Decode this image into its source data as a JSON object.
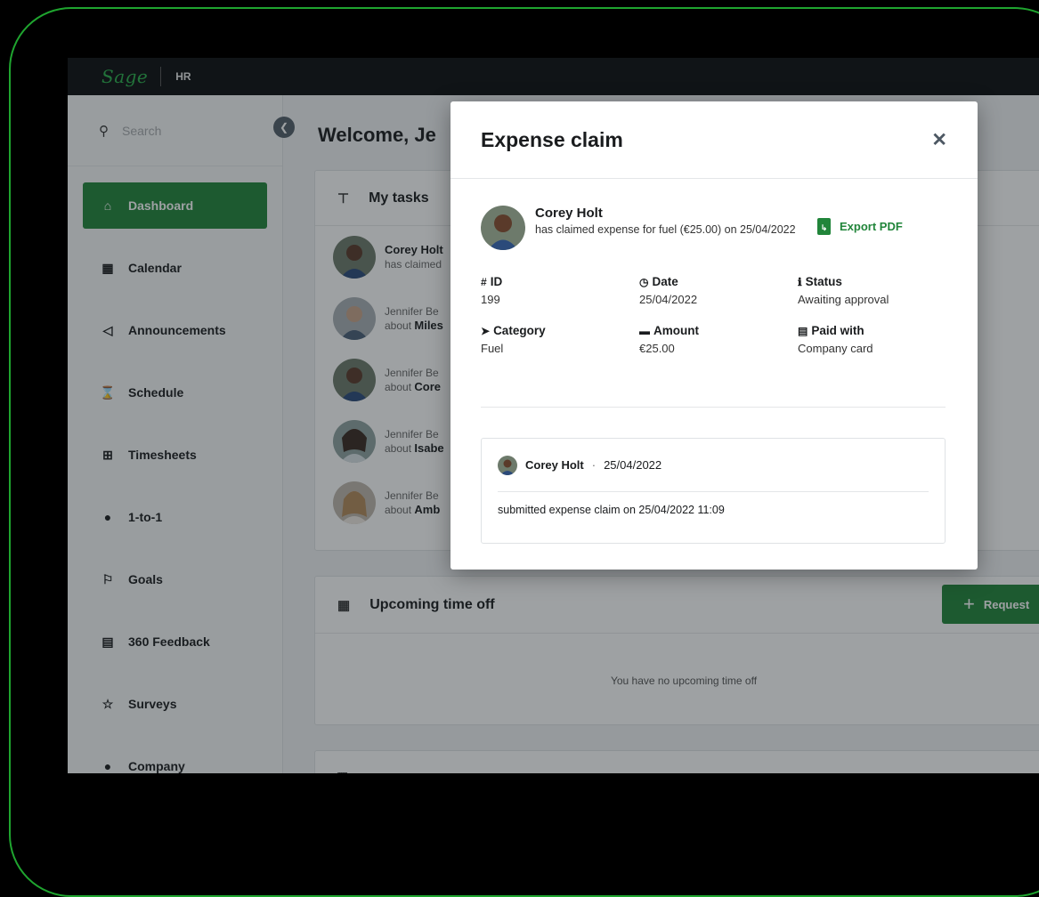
{
  "app": {
    "logo": "Sage",
    "product": "HR"
  },
  "search": {
    "placeholder": "Search"
  },
  "sidebar": {
    "items": [
      {
        "label": "Dashboard",
        "icon": "home-icon",
        "active": true
      },
      {
        "label": "Calendar",
        "icon": "calendar-icon"
      },
      {
        "label": "Announcements",
        "icon": "megaphone-icon"
      },
      {
        "label": "Schedule",
        "icon": "hourglass-icon"
      },
      {
        "label": "Timesheets",
        "icon": "table-icon"
      },
      {
        "label": "1-to-1",
        "icon": "chat-icon"
      },
      {
        "label": "Goals",
        "icon": "flag-icon"
      },
      {
        "label": "360 Feedback",
        "icon": "clipboard-icon"
      },
      {
        "label": "Surveys",
        "icon": "star-icon"
      },
      {
        "label": "Company",
        "icon": "people-icon"
      }
    ]
  },
  "main": {
    "welcome": "Welcome, Je",
    "tasks": {
      "title": "My tasks",
      "items": [
        {
          "line1": "Corey Holt",
          "line2": "has claimed"
        },
        {
          "line1": "Jennifer Be",
          "line2_prefix": "about",
          "line2_bold": "Miles"
        },
        {
          "line1": "Jennifer Be",
          "line2_prefix": "about",
          "line2_bold": "Core"
        },
        {
          "line1": "Jennifer Be",
          "line2_prefix": "about",
          "line2_bold": "Isabe"
        },
        {
          "line1": "Jennifer Be",
          "line2_prefix": "about",
          "line2_bold": "Amb"
        }
      ]
    },
    "timeoff": {
      "title": "Upcoming time off",
      "request_label": "Request",
      "empty": "You have no upcoming time off"
    }
  },
  "modal": {
    "title": "Expense claim",
    "claimant_name": "Corey Holt",
    "claimant_desc": "has claimed expense for fuel (€25.00) on 25/04/2022",
    "export_label": "Export PDF",
    "fields": {
      "id_label": "ID",
      "id_value": "199",
      "date_label": "Date",
      "date_value": "25/04/2022",
      "status_label": "Status",
      "status_value": "Awaiting approval",
      "category_label": "Category",
      "category_value": "Fuel",
      "amount_label": "Amount",
      "amount_value": "€25.00",
      "paid_label": "Paid with",
      "paid_value": "Company card"
    },
    "history": {
      "name": "Corey Holt",
      "separator": "·",
      "date": "25/04/2022",
      "note": "submitted expense claim on 25/04/2022 11:09"
    }
  },
  "colors": {
    "brand": "#21853a",
    "frame": "#1fa52f"
  }
}
